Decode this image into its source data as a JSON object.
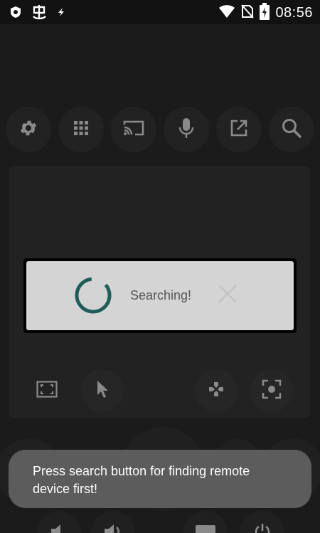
{
  "status_bar": {
    "time": "08:56",
    "left_icons": [
      "shield-icon",
      "ghost-app-icon",
      "lightning-icon"
    ],
    "right_icons": [
      "wifi-icon",
      "no-sim-icon",
      "battery-charging-icon"
    ]
  },
  "toolbar": {
    "buttons": [
      "settings-icon",
      "grid-icon",
      "cast-icon",
      "mic-icon",
      "open-external-icon",
      "search-icon"
    ]
  },
  "touchpad": {
    "buttons": [
      "fullscreen-icon",
      "cursor-icon",
      "gamepad-icon",
      "screenshot-icon"
    ]
  },
  "dialog": {
    "message": "Searching!"
  },
  "toast": {
    "message": "Press search button for finding remote device first!"
  },
  "colors": {
    "background": "#1b1b1b",
    "spinner": "#1e5e57",
    "dialog_bg": "#d4d4d4",
    "toast_bg": "#5c5c5c"
  }
}
